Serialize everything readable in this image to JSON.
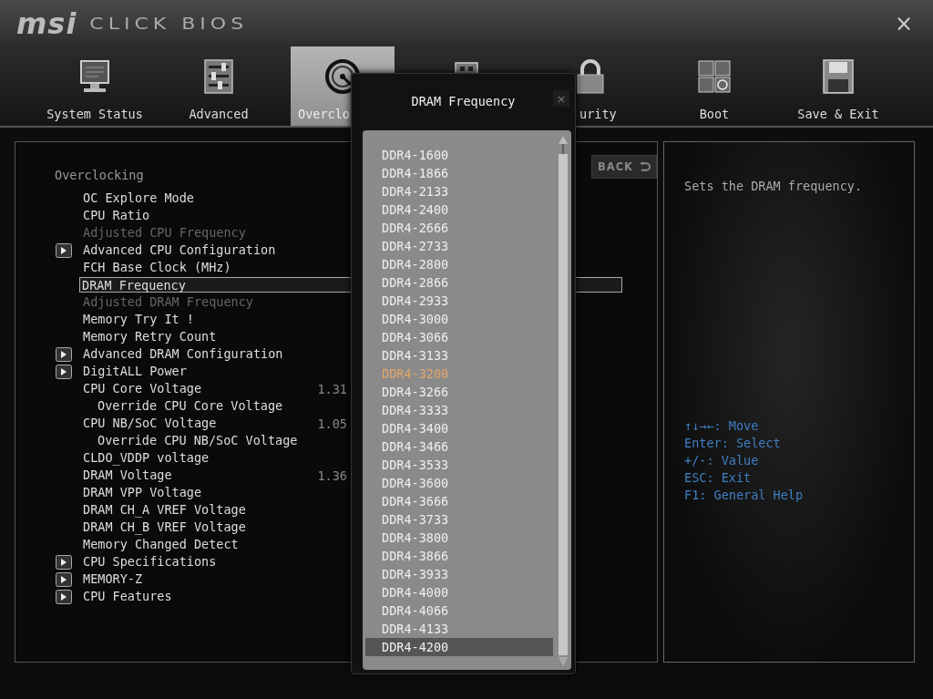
{
  "header": {
    "logo": "msi",
    "product": "CLICK BIOS",
    "close": "×"
  },
  "tabs": [
    {
      "kind": "monitor",
      "label": "System Status",
      "selected": false
    },
    {
      "kind": "sliders",
      "label": "Advanced",
      "selected": false
    },
    {
      "kind": "gauge",
      "label": "Overclo",
      "selected": true
    },
    {
      "kind": "chip",
      "selected": false
    },
    {
      "kind": "lock",
      "label": "urity",
      "selected": false
    },
    {
      "kind": "keys",
      "label": "Boot",
      "selected": false
    },
    {
      "kind": "floppy",
      "label": "Save & Exit",
      "selected": false
    }
  ],
  "settings": {
    "title": "Overclocking",
    "back": "BACK",
    "items": [
      {
        "label": "OC Explore Mode",
        "kind": "plain",
        "disabled": false,
        "selected": false
      },
      {
        "label": "CPU Ratio",
        "kind": "plain",
        "disabled": false,
        "selected": false
      },
      {
        "label": "Adjusted CPU Frequency",
        "kind": "plain",
        "disabled": true,
        "selected": false
      },
      {
        "label": "Advanced CPU Configuration",
        "kind": "submenu",
        "disabled": false,
        "selected": false
      },
      {
        "label": "FCH Base Clock (MHz)",
        "kind": "plain",
        "disabled": false,
        "selected": false
      },
      {
        "label": "DRAM Frequency",
        "kind": "plain",
        "disabled": false,
        "selected": true
      },
      {
        "label": "Adjusted DRAM Frequency",
        "kind": "plain",
        "disabled": true,
        "selected": false
      },
      {
        "label": "Memory Try It !",
        "kind": "plain",
        "disabled": false,
        "selected": false
      },
      {
        "label": "Memory Retry Count",
        "kind": "plain",
        "disabled": false,
        "selected": false
      },
      {
        "label": "Advanced DRAM Configuration",
        "kind": "submenu",
        "disabled": false,
        "selected": false
      },
      {
        "label": "DigitALL Power",
        "kind": "submenu",
        "disabled": false,
        "selected": false
      },
      {
        "label": "CPU Core Voltage",
        "kind": "plain",
        "disabled": false,
        "selected": false,
        "value": "1.31",
        "children": [
          {
            "label": "Override CPU Core Voltage",
            "disabled": false,
            "selected": false
          }
        ]
      },
      {
        "label": "CPU NB/SoC Voltage",
        "kind": "plain",
        "disabled": false,
        "selected": false,
        "value": "1.05",
        "children": [
          {
            "label": "Override CPU NB/SoC Voltage",
            "disabled": false,
            "selected": false
          }
        ]
      },
      {
        "label": "CLDO_VDDP voltage",
        "kind": "plain",
        "disabled": false,
        "selected": false
      },
      {
        "label": "DRAM Voltage",
        "kind": "plain",
        "disabled": false,
        "selected": false,
        "value": "1.36"
      },
      {
        "label": "DRAM VPP Voltage",
        "kind": "plain",
        "disabled": false,
        "selected": false
      },
      {
        "label": "DRAM CH_A VREF Voltage",
        "kind": "plain",
        "disabled": false,
        "selected": false
      },
      {
        "label": "DRAM CH_B VREF Voltage",
        "kind": "plain",
        "disabled": false,
        "selected": false
      },
      {
        "label": "Memory Changed Detect",
        "kind": "plain",
        "disabled": false,
        "selected": false
      },
      {
        "label": "CPU Specifications",
        "kind": "submenu",
        "disabled": false,
        "selected": false
      },
      {
        "label": "MEMORY-Z",
        "kind": "submenu",
        "disabled": false,
        "selected": false
      },
      {
        "label": "CPU Features",
        "kind": "submenu",
        "disabled": false,
        "selected": false
      }
    ]
  },
  "help": {
    "description": "Sets the DRAM frequency.",
    "keys": [
      "↑↓→←: Move",
      "Enter: Select",
      "+/-: Value",
      "ESC: Exit",
      "F1: General Help"
    ]
  },
  "dialog": {
    "title": "DRAM Frequency",
    "close": "×",
    "options": [
      {
        "label": "DDR4-1600",
        "current": false,
        "selected": false
      },
      {
        "label": "DDR4-1866",
        "current": false,
        "selected": false
      },
      {
        "label": "DDR4-2133",
        "current": false,
        "selected": false
      },
      {
        "label": "DDR4-2400",
        "current": false,
        "selected": false
      },
      {
        "label": "DDR4-2666",
        "current": false,
        "selected": false
      },
      {
        "label": "DDR4-2733",
        "current": false,
        "selected": false
      },
      {
        "label": "DDR4-2800",
        "current": false,
        "selected": false
      },
      {
        "label": "DDR4-2866",
        "current": false,
        "selected": false
      },
      {
        "label": "DDR4-2933",
        "current": false,
        "selected": false
      },
      {
        "label": "DDR4-3000",
        "current": false,
        "selected": false
      },
      {
        "label": "DDR4-3066",
        "current": false,
        "selected": false
      },
      {
        "label": "DDR4-3133",
        "current": false,
        "selected": false
      },
      {
        "label": "DDR4-3200",
        "current": true,
        "selected": false
      },
      {
        "label": "DDR4-3266",
        "current": false,
        "selected": false
      },
      {
        "label": "DDR4-3333",
        "current": false,
        "selected": false
      },
      {
        "label": "DDR4-3400",
        "current": false,
        "selected": false
      },
      {
        "label": "DDR4-3466",
        "current": false,
        "selected": false
      },
      {
        "label": "DDR4-3533",
        "current": false,
        "selected": false
      },
      {
        "label": "DDR4-3600",
        "current": false,
        "selected": false
      },
      {
        "label": "DDR4-3666",
        "current": false,
        "selected": false
      },
      {
        "label": "DDR4-3733",
        "current": false,
        "selected": false
      },
      {
        "label": "DDR4-3800",
        "current": false,
        "selected": false
      },
      {
        "label": "DDR4-3866",
        "current": false,
        "selected": false
      },
      {
        "label": "DDR4-3933",
        "current": false,
        "selected": false
      },
      {
        "label": "DDR4-4000",
        "current": false,
        "selected": false
      },
      {
        "label": "DDR4-4066",
        "current": false,
        "selected": false
      },
      {
        "label": "DDR4-4133",
        "current": false,
        "selected": false
      },
      {
        "label": "DDR4-4200",
        "current": false,
        "selected": true
      }
    ]
  }
}
